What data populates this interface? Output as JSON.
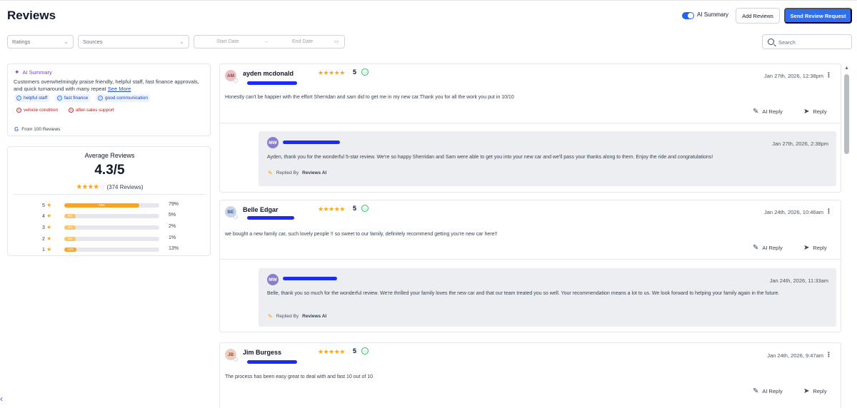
{
  "header": {
    "title": "Reviews",
    "ai_summary_toggle_label": "AI Summary",
    "add_reviews_label": "Add Reviews",
    "send_request_label": "Send Review Request"
  },
  "filters": {
    "ratings_placeholder": "Ratings",
    "sources_placeholder": "Sources",
    "start_date_placeholder": "Start Date",
    "end_date_placeholder": "End Date",
    "date_arrow": "→",
    "search_placeholder": "Search"
  },
  "ai_summary": {
    "title": "AI Summary",
    "text": "Customers overwhelmingly praise friendly, helpful staff, fast finance approvals, and quick turnaround with many repeat",
    "see_more": "See More",
    "positive_tags": [
      "helpful staff",
      "fast finance",
      "good communication"
    ],
    "negative_tags": [
      "vehicle condition",
      "after-sales support"
    ],
    "source_note": "From 100 Reviews"
  },
  "average": {
    "title": "Average Reviews",
    "score": "4.3/5",
    "stars_filled": 4,
    "count_text": "(374 Reviews)",
    "breakdown": [
      {
        "stars": "5",
        "percent": 79,
        "label": "79%",
        "bar_label": "79%"
      },
      {
        "stars": "4",
        "percent": 5,
        "label": "5%",
        "bar_label": "5%"
      },
      {
        "stars": "3",
        "percent": 2,
        "label": "2%",
        "bar_label": "2%"
      },
      {
        "stars": "2",
        "percent": 1,
        "label": "1%",
        "bar_label": "1%"
      },
      {
        "stars": "1",
        "percent": 13,
        "label": "13%",
        "bar_label": "13%"
      }
    ]
  },
  "reviews": [
    {
      "initials": "AM",
      "avatar_bg": "#e7c3c6",
      "avatar_fg": "#9b3b46",
      "name": "ayden mcdonald",
      "stars": "★★★★★",
      "rating": "5",
      "date": "Jan 27th, 2026, 12:38pm",
      "text": "Honestly can't be happier with the effort Sherridan and sam did to get me in my new car.Thank you for all the work you put in 10/10",
      "ai_reply_label": "AI Reply",
      "reply_label": "Reply",
      "reply": {
        "initials": "MW",
        "date": "Jan 27th, 2026, 2:38pm",
        "text": "Ayden, thank you for the wonderful 5-star review. We're so happy Sherridan and Sam were able to get you into your new car and we'll pass your thanks along to them. Enjoy the ride and congratulations!",
        "replied_by_prefix": "Replied By",
        "replied_by": "Reviews AI"
      }
    },
    {
      "initials": "BE",
      "avatar_bg": "#c7d4ea",
      "avatar_fg": "#3d5a8a",
      "name": "Belle Edgar",
      "stars": "★★★★★",
      "rating": "5",
      "date": "Jan 24th, 2026, 10:46am",
      "text": "we bought a new family car, such lovely people !! so sweet to our family, definitely recommend getting you're new car here!!",
      "ai_reply_label": "AI Reply",
      "reply_label": "Reply",
      "reply": {
        "initials": "MW",
        "date": "Jan 24th, 2026, 11:33am",
        "text": "Belle, thank you so much for the wonderful review. We're thrilled your family loves the new car and that our team treated you so well. Your recommendation means a lot to us. We look forward to helping your family again in the future.",
        "replied_by_prefix": "Replied By",
        "replied_by": "Reviews AI"
      }
    },
    {
      "initials": "JB",
      "avatar_bg": "#eccfc4",
      "avatar_fg": "#a2492c",
      "name": "Jim Burgess",
      "stars": "★★★★★",
      "rating": "5",
      "date": "Jan 24th, 2026, 9:47am",
      "text": "The process has been easy great to deal with and fast 10 out of 10",
      "ai_reply_label": "AI Reply",
      "reply_label": "Reply"
    }
  ],
  "colors": {
    "primary": "#2f6fed",
    "star": "#f5a623",
    "ai_purple": "#7c3aed",
    "redaction": "#1d2cf2",
    "positive": "#22c55e"
  }
}
